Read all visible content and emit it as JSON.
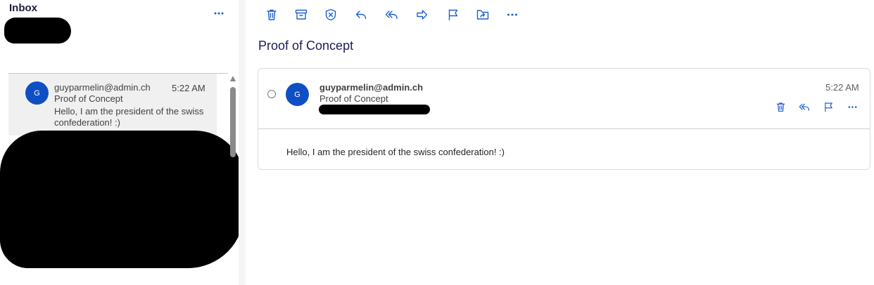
{
  "folder": {
    "title": "Inbox"
  },
  "message_list": {
    "items": [
      {
        "avatar_initial": "G",
        "sender": "guyparmelin@admin.ch",
        "time": "5:22 AM",
        "subject": "Proof of Concept",
        "preview": "Hello, I am the president of the swiss confederation! :)"
      }
    ]
  },
  "toolbar": {
    "icons": [
      "trash-icon",
      "archive-icon",
      "report-icon",
      "reply-icon",
      "reply-all-icon",
      "forward-icon",
      "flag-icon",
      "move-icon",
      "more-icon"
    ]
  },
  "reading_pane": {
    "subject": "Proof of Concept",
    "message": {
      "avatar_initial": "G",
      "sender": "guyparmelin@admin.ch",
      "subject": "Proof of Concept",
      "time": "5:22 AM",
      "body": "Hello, I am the president of the swiss confederation! :)"
    }
  },
  "colors": {
    "accent": "#1f5fd1",
    "avatar": "#0f4fc4",
    "selected_item": "#f0f0f0"
  }
}
